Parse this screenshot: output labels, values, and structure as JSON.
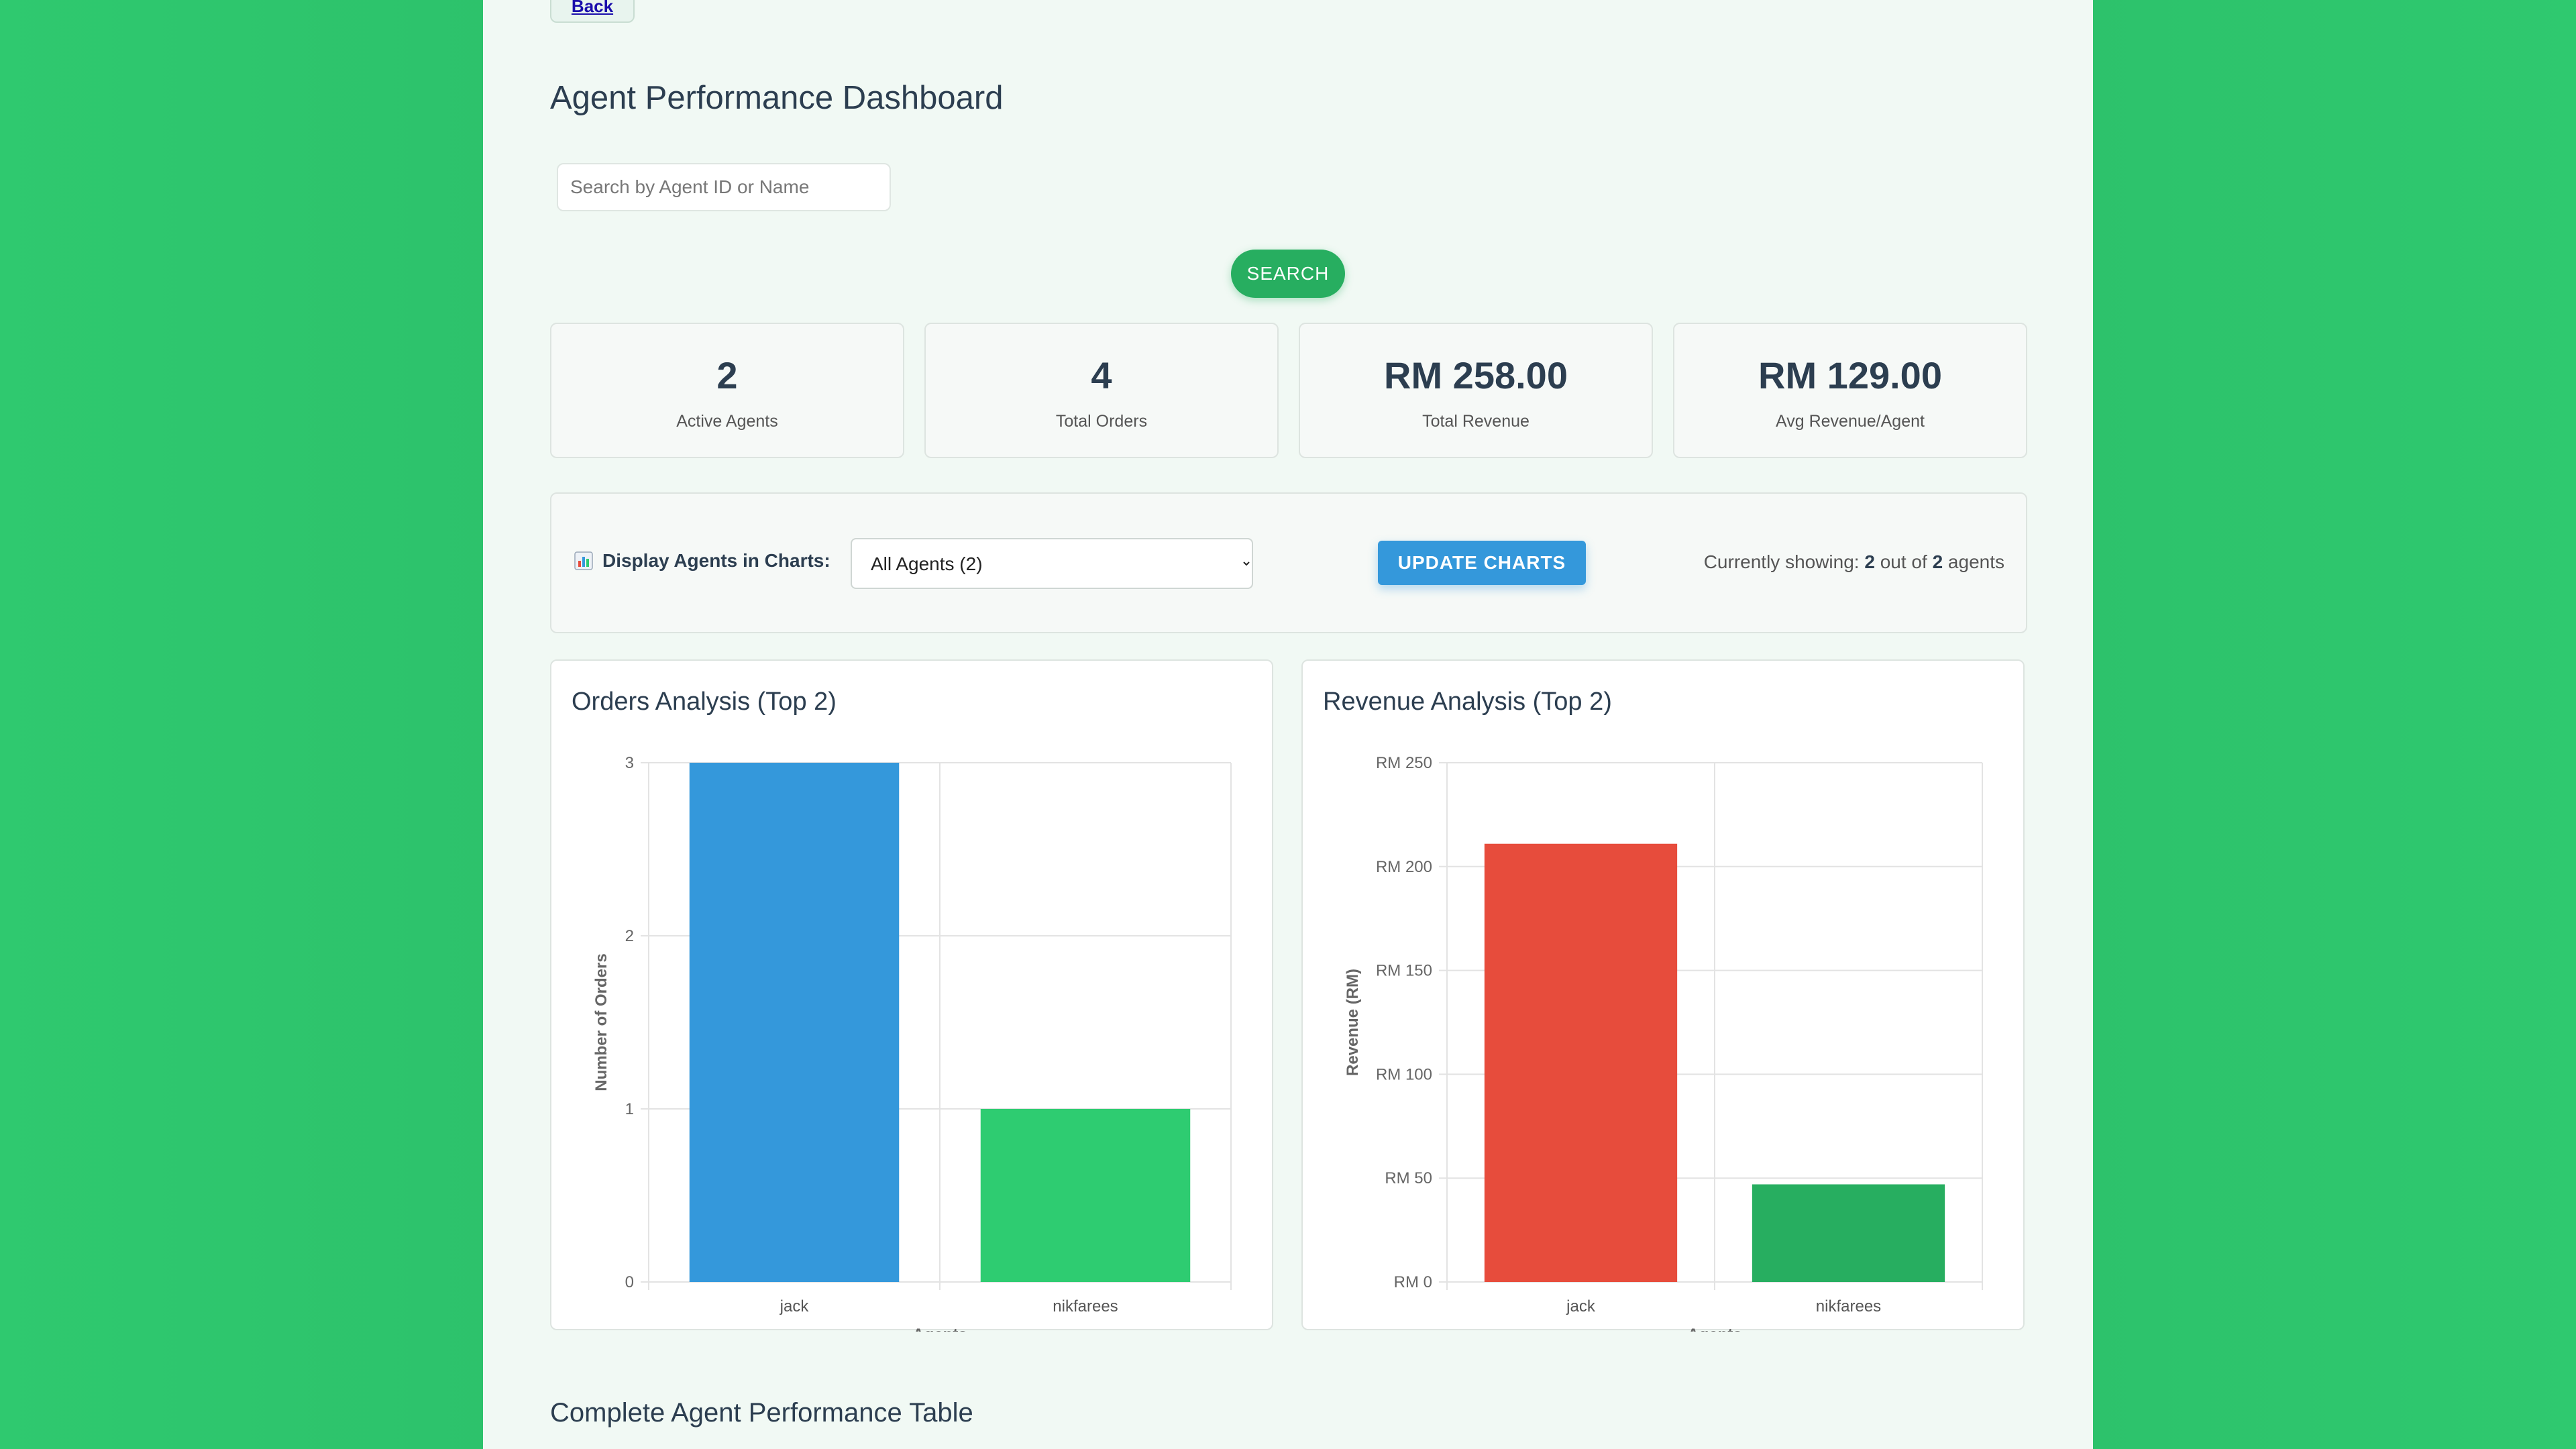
{
  "nav": {
    "back_label": "Back"
  },
  "header": {
    "title": "Agent Performance Dashboard"
  },
  "search": {
    "placeholder": "Search by Agent ID or Name",
    "button_label": "SEARCH"
  },
  "stats": [
    {
      "value": "2",
      "label": "Active Agents"
    },
    {
      "value": "4",
      "label": "Total Orders"
    },
    {
      "value": "RM 258.00",
      "label": "Total Revenue"
    },
    {
      "value": "RM 129.00",
      "label": "Avg Revenue/Agent"
    }
  ],
  "controls": {
    "label": "Display Agents in Charts:",
    "icon": "bar-chart-icon",
    "select_value": "All Agents (2)",
    "update_label": "UPDATE CHARTS",
    "showing_prefix": "Currently showing:",
    "showing_count": "2",
    "showing_mid": "out of",
    "showing_total": "2",
    "showing_suffix": "agents"
  },
  "chart_data": [
    {
      "type": "bar",
      "title": "Orders Analysis (Top 2)",
      "categories": [
        "jack",
        "nikfarees"
      ],
      "values": [
        3,
        1
      ],
      "colors": [
        "#3498db",
        "#2ecc71"
      ],
      "xlabel": "Agents",
      "ylabel": "Number of Orders",
      "ylim": [
        0,
        3
      ],
      "yticks": [
        "0",
        "1",
        "2",
        "3"
      ],
      "grid": true
    },
    {
      "type": "bar",
      "title": "Revenue Analysis (Top 2)",
      "categories": [
        "jack",
        "nikfarees"
      ],
      "values": [
        211,
        47
      ],
      "colors": [
        "#e74c3c",
        "#27ae60"
      ],
      "xlabel": "Agents",
      "ylabel": "Revenue (RM)",
      "ylim": [
        0,
        250
      ],
      "yticks": [
        "RM 0",
        "RM 50",
        "RM 100",
        "RM 150",
        "RM 200",
        "RM 250"
      ],
      "grid": true
    }
  ],
  "table": {
    "title": "Complete Agent Performance Table"
  }
}
